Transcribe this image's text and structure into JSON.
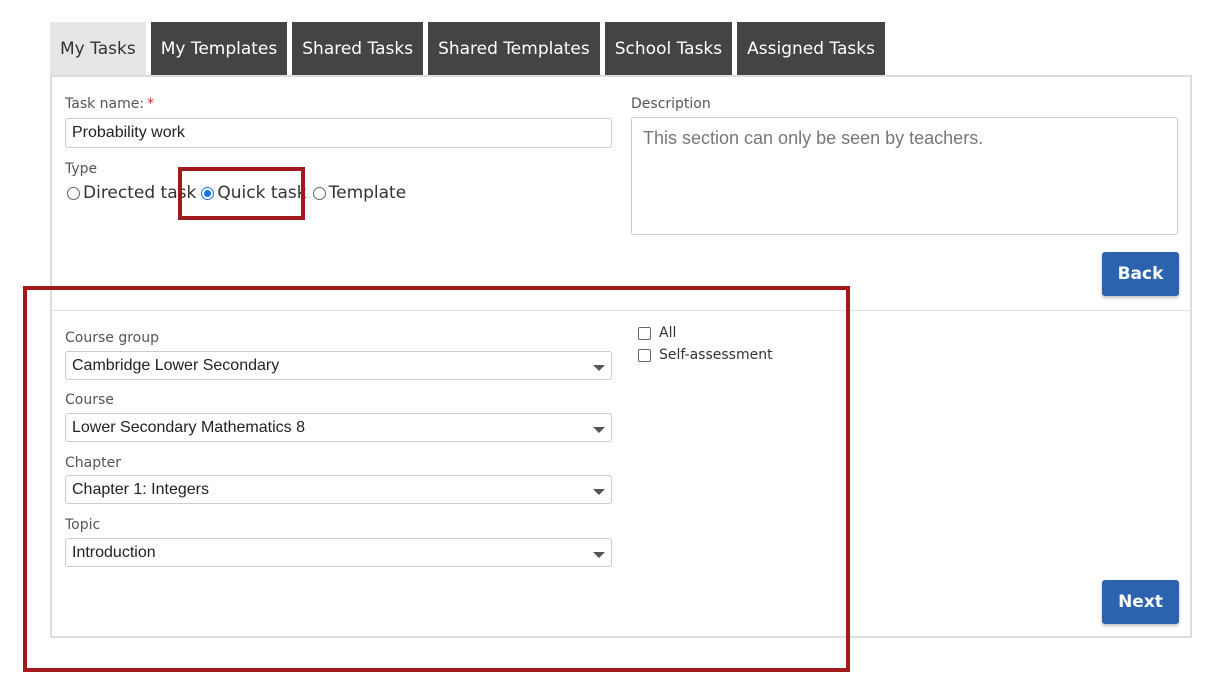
{
  "tabs": [
    {
      "label": "My Tasks",
      "active": true
    },
    {
      "label": "My Templates",
      "active": false
    },
    {
      "label": "Shared Tasks",
      "active": false
    },
    {
      "label": "Shared Templates",
      "active": false
    },
    {
      "label": "School Tasks",
      "active": false
    },
    {
      "label": "Assigned Tasks",
      "active": false
    }
  ],
  "form": {
    "task_name_label": "Task name:",
    "required_marker": "*",
    "task_name_value": "Probability work",
    "type_label": "Type",
    "type_options": [
      "Directed task",
      "Quick task",
      "Template"
    ],
    "type_selected": "Quick task",
    "description_label": "Description",
    "description_value": "This section can only be seen by teachers.",
    "back_label": "Back"
  },
  "filters": {
    "course_group_label": "Course group",
    "course_group_value": "Cambridge Lower Secondary",
    "course_label": "Course",
    "course_value": "Lower Secondary Mathematics 8",
    "chapter_label": "Chapter",
    "chapter_value": "Chapter 1: Integers",
    "topic_label": "Topic",
    "topic_value": "Introduction",
    "checkbox_all": "All",
    "checkbox_self_assessment": "Self-assessment",
    "next_label": "Next"
  },
  "colors": {
    "accent_button": "#2b63ae",
    "active_tab": "#e6e6e6",
    "inactive_tab": "#444444",
    "highlight_border": "#a3181b",
    "radio_selected": "#1a73e8"
  }
}
